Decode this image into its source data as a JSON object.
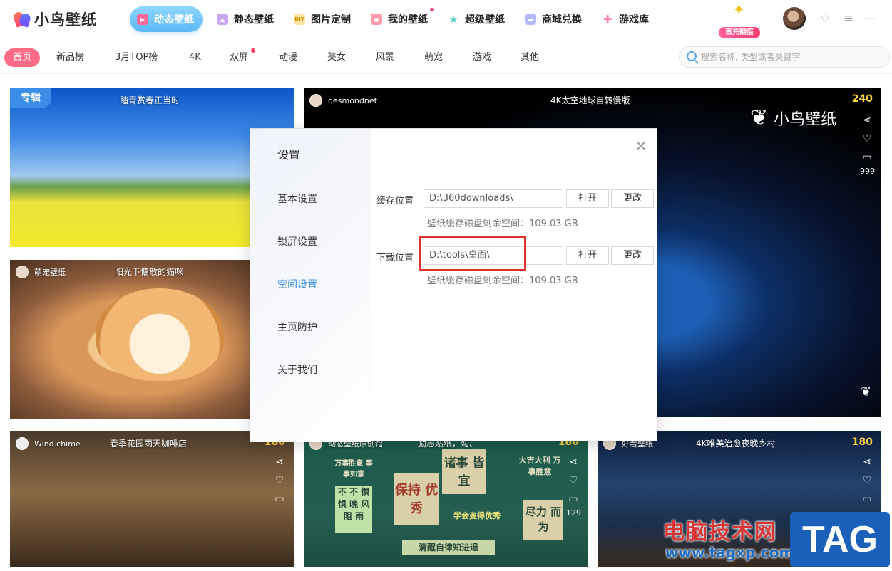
{
  "app": {
    "name": "小鸟壁纸"
  },
  "nav": {
    "items": [
      {
        "label": "动态壁纸"
      },
      {
        "label": "静态壁纸"
      },
      {
        "label": "图片定制",
        "icon_text": "DIY"
      },
      {
        "label": "我的壁纸"
      },
      {
        "label": "超级壁纸"
      },
      {
        "label": "商城兑换"
      },
      {
        "label": "游戏库"
      }
    ],
    "promo_badge": "首充翻倍"
  },
  "categories": [
    "首页",
    "新品榜",
    "3月TOP榜",
    "4K",
    "双屏",
    "动漫",
    "美女",
    "风景",
    "萌宠",
    "游戏",
    "其他"
  ],
  "search": {
    "placeholder": "搜索名称, 类型或者关键字"
  },
  "cards": {
    "c1": {
      "tag": "专辑",
      "title": "踏青赏春正当时"
    },
    "c2": {
      "user": "desmondnet",
      "title": "4K太空地球自转慢版",
      "count": "240",
      "comments": "999",
      "logo_text": "小鸟壁纸"
    },
    "c3": {
      "user": "萌宠壁纸",
      "title": "阳光下慵散的猫咪"
    },
    "c4": {
      "user": "Wind.chime",
      "title": "春季花园雨天咖啡店",
      "count": "180"
    },
    "c5": {
      "user": "动态壁纸原创馆",
      "title": "励志贴纸，勾、",
      "count": "180",
      "comments": "129",
      "notes": [
        "万事胜意 事事如意",
        "诸事 皆宜",
        "大吉大利 万事胜意",
        "不 不 惧 惧 晚 风 阻 雨",
        "保持 优秀",
        "学会变得优秀",
        "尽力 而为",
        "清醒自律知进退"
      ]
    },
    "c6": {
      "user": "好看壁纸",
      "title": "4K唯美治愈夜晚乡村",
      "count": "180"
    }
  },
  "dialog": {
    "title": "设置",
    "menu": [
      "基本设置",
      "锁屏设置",
      "空间设置",
      "主页防护",
      "关于我们"
    ],
    "active_menu": "空间设置",
    "cache": {
      "label": "缓存位置",
      "path": "D:\\360downloads\\",
      "hint": "壁纸缓存磁盘剩余空间：109.03 GB"
    },
    "download": {
      "label": "下载位置",
      "path": "D:\\tools\\桌面\\",
      "hint": "壁纸缓存磁盘剩余空间：109.03 GB"
    },
    "open_label": "打开",
    "change_label": "更改"
  },
  "watermark": {
    "text": "电脑技术网",
    "url": "www.tagxp.com",
    "tag": "TAG"
  },
  "colors": {
    "accent": "#3b8eea",
    "pink": "#ff6b86",
    "highlight": "#e0302e"
  }
}
